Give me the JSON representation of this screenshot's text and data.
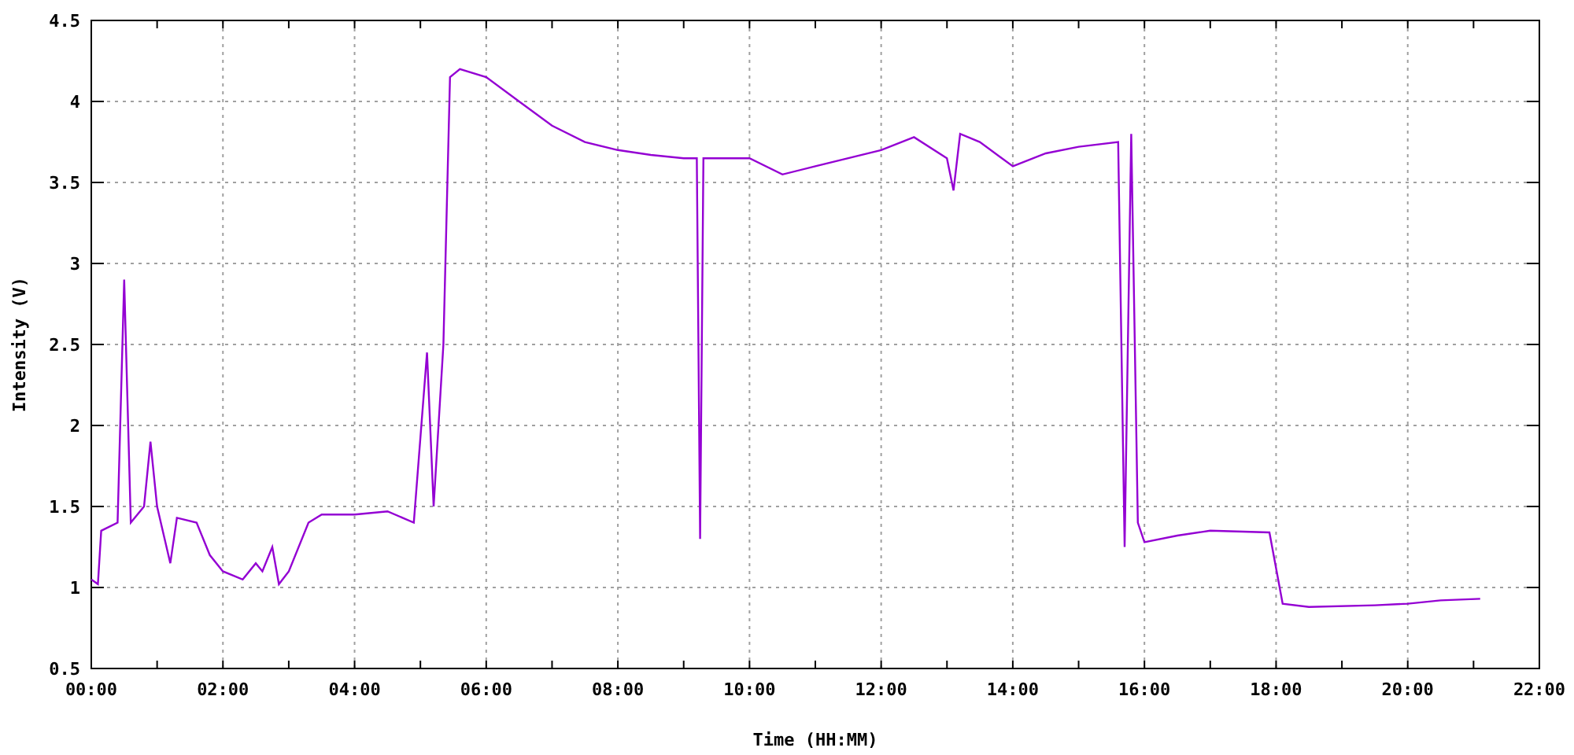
{
  "chart": {
    "chart_data": {
      "type": "line",
      "xlabel": "Time (HH:MM)",
      "ylabel": "Intensity (V)",
      "x": [
        0,
        0.1,
        0.15,
        0.4,
        0.5,
        0.6,
        0.8,
        0.9,
        1.0,
        1.2,
        1.3,
        1.6,
        1.8,
        2.0,
        2.3,
        2.5,
        2.6,
        2.75,
        2.85,
        3.0,
        3.3,
        3.5,
        4.0,
        4.5,
        4.9,
        5.1,
        5.2,
        5.35,
        5.45,
        5.6,
        6.0,
        6.5,
        7.0,
        7.5,
        8.0,
        8.5,
        9.0,
        9.2,
        9.25,
        9.3,
        10.0,
        10.5,
        11.0,
        11.5,
        12.0,
        12.5,
        13.0,
        13.1,
        13.2,
        13.5,
        14.0,
        14.5,
        15.0,
        15.6,
        15.7,
        15.8,
        15.9,
        16.0,
        16.5,
        17.0,
        17.9,
        18.1,
        18.5,
        19.5,
        20.0,
        20.5,
        21.1
      ],
      "grid": true,
      "series": [
        {
          "color": "#9400d3",
          "values": [
            1.05,
            1.02,
            1.35,
            1.4,
            2.9,
            1.4,
            1.5,
            1.9,
            1.5,
            1.15,
            1.43,
            1.4,
            1.2,
            1.1,
            1.05,
            1.15,
            1.1,
            1.25,
            1.02,
            1.1,
            1.4,
            1.45,
            1.45,
            1.47,
            1.4,
            2.45,
            1.5,
            2.5,
            4.15,
            4.2,
            4.15,
            4.0,
            3.85,
            3.75,
            3.7,
            3.67,
            3.65,
            3.65,
            1.3,
            3.65,
            3.65,
            3.55,
            3.6,
            3.65,
            3.7,
            3.78,
            3.65,
            3.45,
            3.8,
            3.75,
            3.6,
            3.68,
            3.72,
            3.75,
            1.25,
            3.8,
            1.4,
            1.28,
            1.32,
            1.35,
            1.34,
            0.9,
            0.88,
            0.89,
            0.9,
            0.92,
            0.93
          ]
        }
      ],
      "xlim": [
        0,
        22
      ],
      "ylim": [
        0.5,
        4.5
      ],
      "xticks": [
        {
          "value": 0,
          "label": "00:00"
        },
        {
          "value": 2,
          "label": "02:00"
        },
        {
          "value": 4,
          "label": "04:00"
        },
        {
          "value": 6,
          "label": "06:00"
        },
        {
          "value": 8,
          "label": "08:00"
        },
        {
          "value": 10,
          "label": "10:00"
        },
        {
          "value": 12,
          "label": "12:00"
        },
        {
          "value": 14,
          "label": "14:00"
        },
        {
          "value": 16,
          "label": "16:00"
        },
        {
          "value": 18,
          "label": "18:00"
        },
        {
          "value": 20,
          "label": "20:00"
        },
        {
          "value": 22,
          "label": "22:00"
        }
      ],
      "yticks": [
        0.5,
        1,
        1.5,
        2,
        2.5,
        3,
        3.5,
        4,
        4.5
      ]
    }
  }
}
